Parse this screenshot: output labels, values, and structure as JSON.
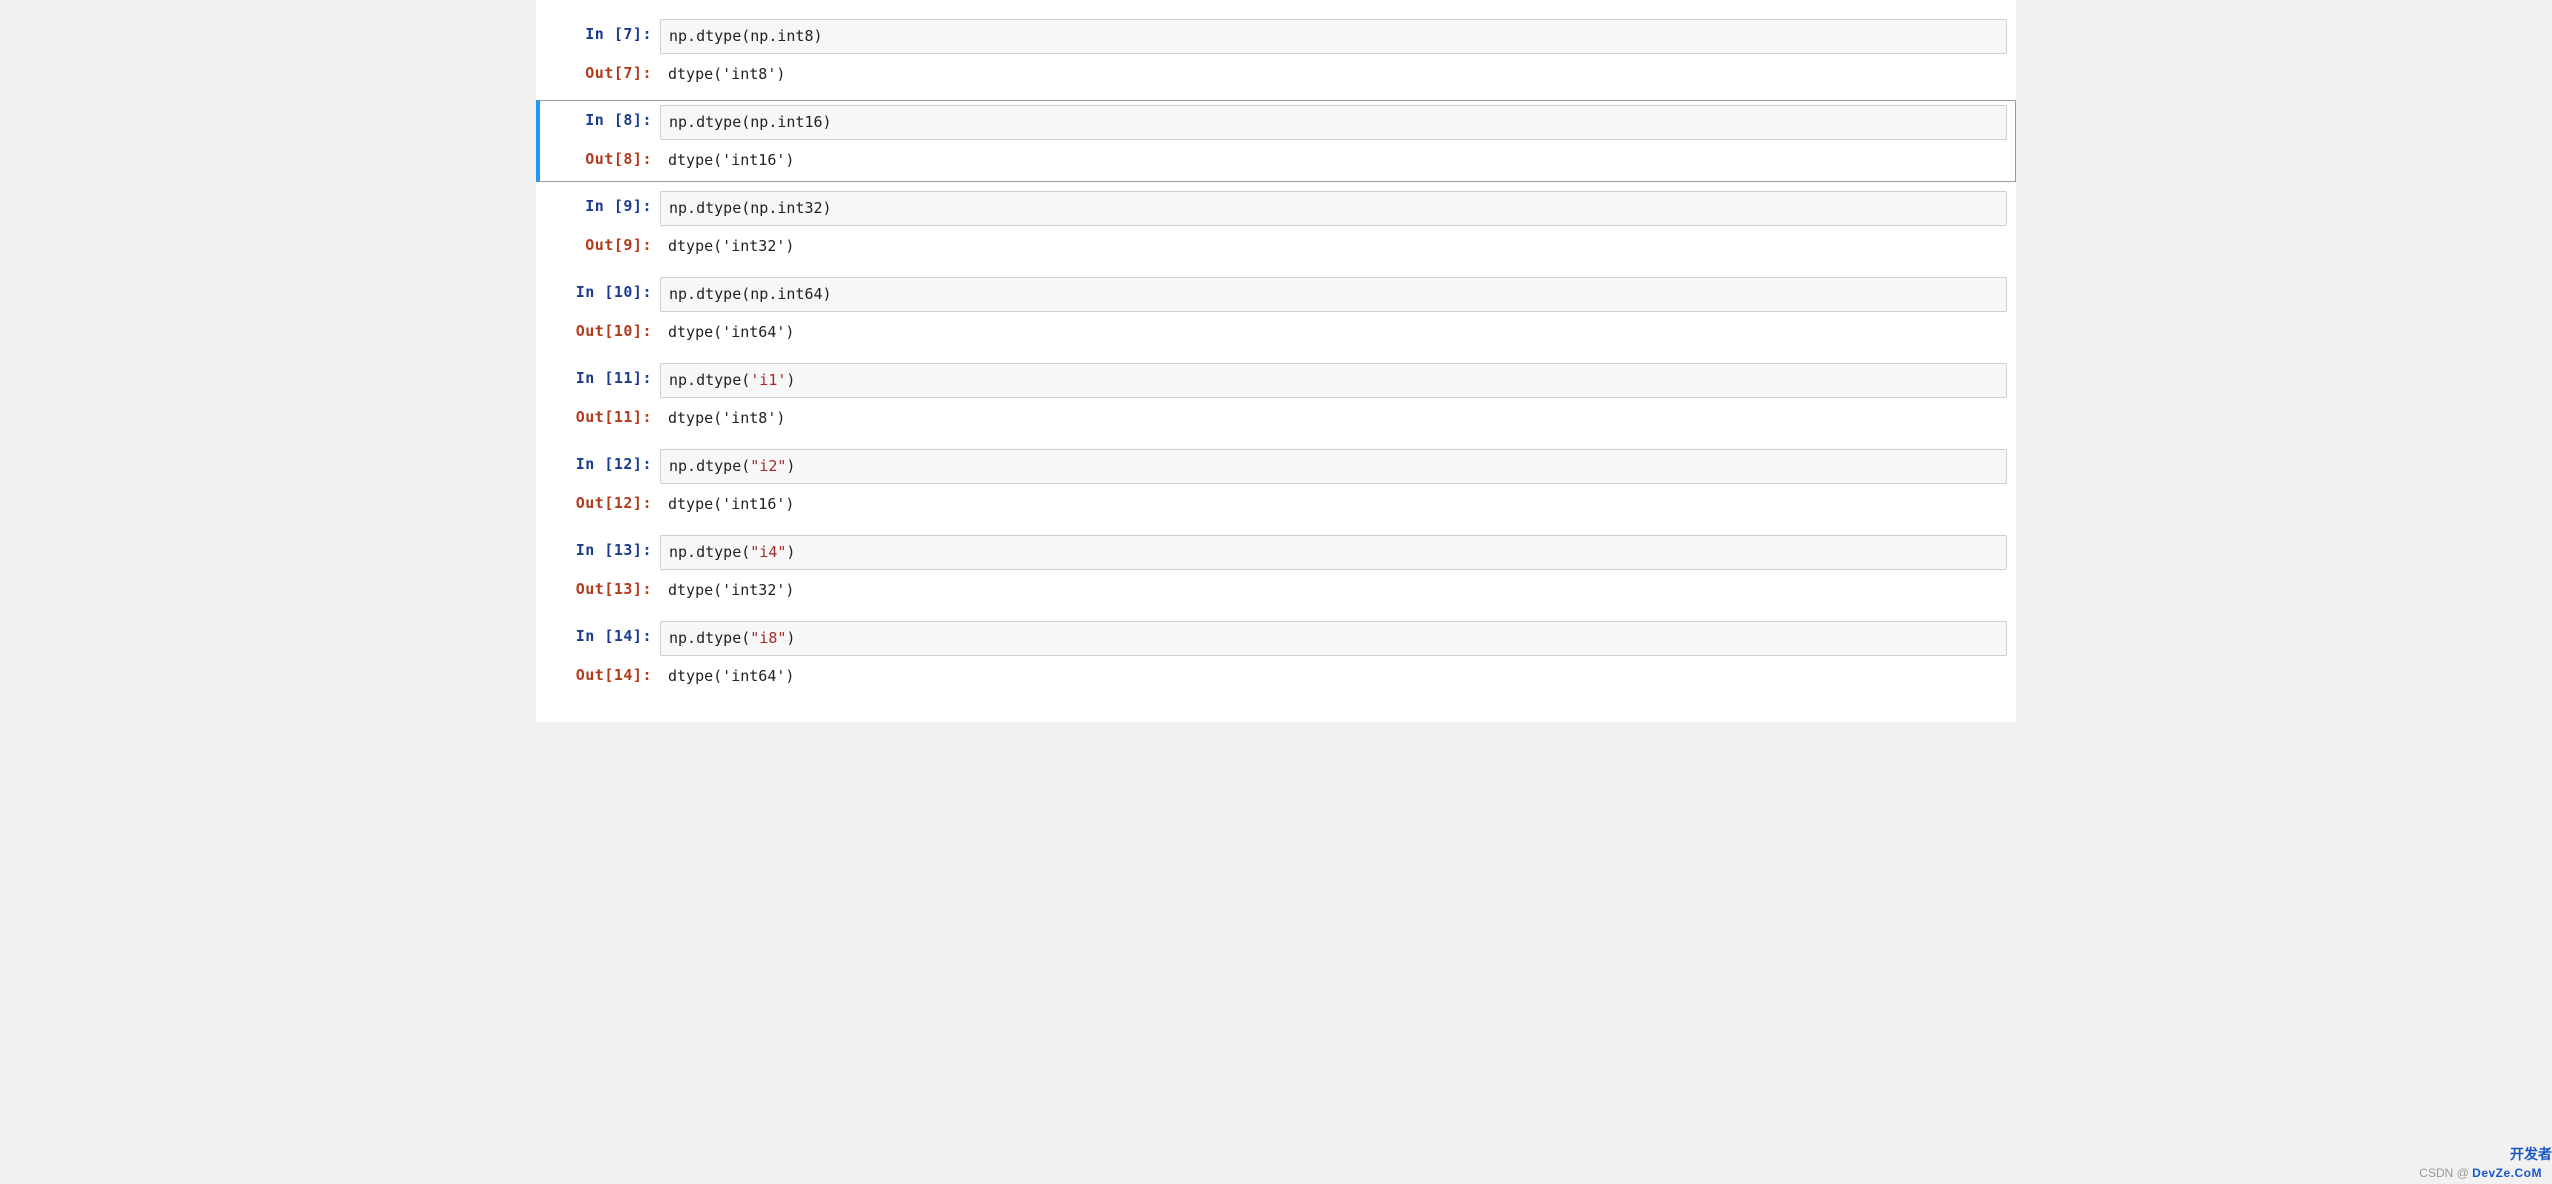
{
  "cells": [
    {
      "selected": false,
      "in_prompt": "In [7]:",
      "out_prompt": "Out[7]:",
      "code_plain": "np.dtype(np.int8)",
      "code_prefix": "np.dtype(np.int8)",
      "code_str": "",
      "code_suffix": "",
      "output": "dtype('int8')"
    },
    {
      "selected": true,
      "in_prompt": "In [8]:",
      "out_prompt": "Out[8]:",
      "code_plain": "np.dtype(np.int16)",
      "code_prefix": "np.dtype(np.int16)",
      "code_str": "",
      "code_suffix": "",
      "output": "dtype('int16')"
    },
    {
      "selected": false,
      "in_prompt": "In [9]:",
      "out_prompt": "Out[9]:",
      "code_plain": "np.dtype(np.int32)",
      "code_prefix": "np.dtype(np.int32)",
      "code_str": "",
      "code_suffix": "",
      "output": "dtype('int32')"
    },
    {
      "selected": false,
      "in_prompt": "In [10]:",
      "out_prompt": "Out[10]:",
      "code_plain": "np.dtype(np.int64)",
      "code_prefix": "np.dtype(np.int64)",
      "code_str": "",
      "code_suffix": "",
      "output": "dtype('int64')"
    },
    {
      "selected": false,
      "in_prompt": "In [11]:",
      "out_prompt": "Out[11]:",
      "code_plain": "np.dtype('i1')",
      "code_prefix": "np.dtype(",
      "code_str": "'i1'",
      "code_suffix": ")",
      "output": "dtype('int8')"
    },
    {
      "selected": false,
      "in_prompt": "In [12]:",
      "out_prompt": "Out[12]:",
      "code_plain": "np.dtype(\"i2\")",
      "code_prefix": "np.dtype(",
      "code_str": "\"i2\"",
      "code_suffix": ")",
      "output": "dtype('int16')"
    },
    {
      "selected": false,
      "in_prompt": "In [13]:",
      "out_prompt": "Out[13]:",
      "code_plain": "np.dtype(\"i4\")",
      "code_prefix": "np.dtype(",
      "code_str": "\"i4\"",
      "code_suffix": ")",
      "output": "dtype('int32')"
    },
    {
      "selected": false,
      "in_prompt": "In [14]:",
      "out_prompt": "Out[14]:",
      "code_plain": "np.dtype(\"i8\")",
      "code_prefix": "np.dtype(",
      "code_str": "\"i8\"",
      "code_suffix": ")",
      "output": "dtype('int64')"
    }
  ],
  "watermark_prefix": "CSDN @",
  "watermark_brand": "DevZe.CoM",
  "dev_badge": "开发者"
}
